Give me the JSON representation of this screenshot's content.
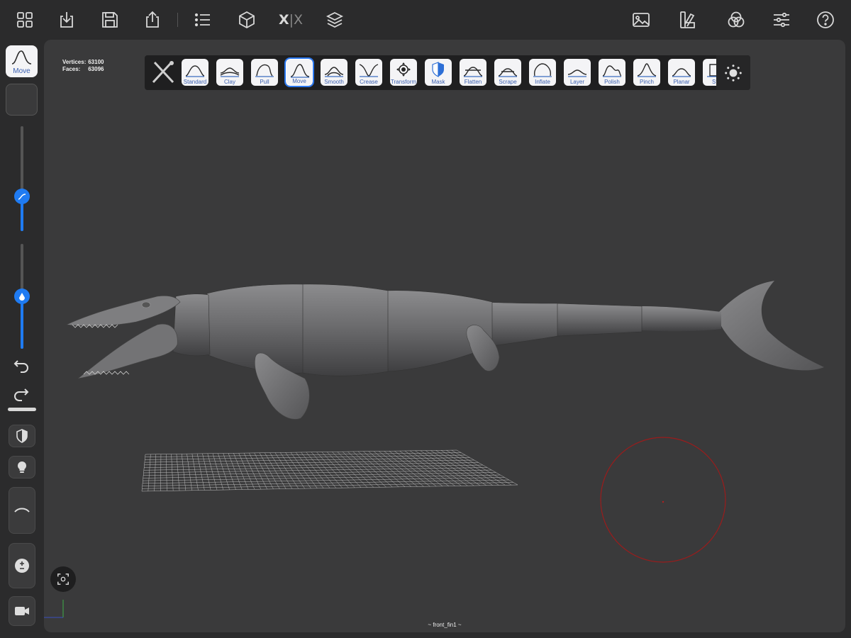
{
  "topbar": {
    "left_icons": [
      "grid-icon",
      "import-icon",
      "save-icon",
      "share-icon",
      "list-icon",
      "cube-icon",
      "mirror-icon",
      "layers-icon"
    ],
    "mirror_label_a": "X",
    "mirror_sep": "|",
    "mirror_label_b": "X",
    "right_icons": [
      "image-icon",
      "palette-icon",
      "color-mix-icon",
      "sliders-icon",
      "help-icon"
    ]
  },
  "stats": {
    "vertices_label": "Vertices:",
    "vertices_value": "63100",
    "faces_label": "Faces:",
    "faces_value": "63096"
  },
  "brushes": [
    {
      "label": "Standard"
    },
    {
      "label": "Clay"
    },
    {
      "label": "Pull"
    },
    {
      "label": "Move",
      "active": true
    },
    {
      "label": "Smooth"
    },
    {
      "label": "Crease"
    },
    {
      "label": "Transform"
    },
    {
      "label": "Mask"
    },
    {
      "label": "Flatten"
    },
    {
      "label": "Scrape"
    },
    {
      "label": "Inflate"
    },
    {
      "label": "Layer"
    },
    {
      "label": "Polish"
    },
    {
      "label": "Pinch"
    },
    {
      "label": "Planar"
    },
    {
      "label": "Sta"
    }
  ],
  "left_panel": {
    "current_tool_label": "Move",
    "radius_slider_value": 0.33,
    "intensity_slider_value": 0.5,
    "undo_icon": "undo-icon",
    "redo_icon": "redo-icon",
    "mask_icon": "mask-shield-icon",
    "light_icon": "bulb-icon",
    "stroke_icon": "stroke-curve-icon",
    "subdiv_icon": "plus-minus-icon",
    "camera_icon": "camera-icon"
  },
  "viewport": {
    "object_label": "~ front_fin1 ~"
  },
  "colors": {
    "accent": "#1f7bf2",
    "brush_label": "#3a5fb0",
    "viewport_bg": "#3a3a3b",
    "app_bg": "#2b2b2c",
    "cursor_ring": "#9a1c1c"
  }
}
